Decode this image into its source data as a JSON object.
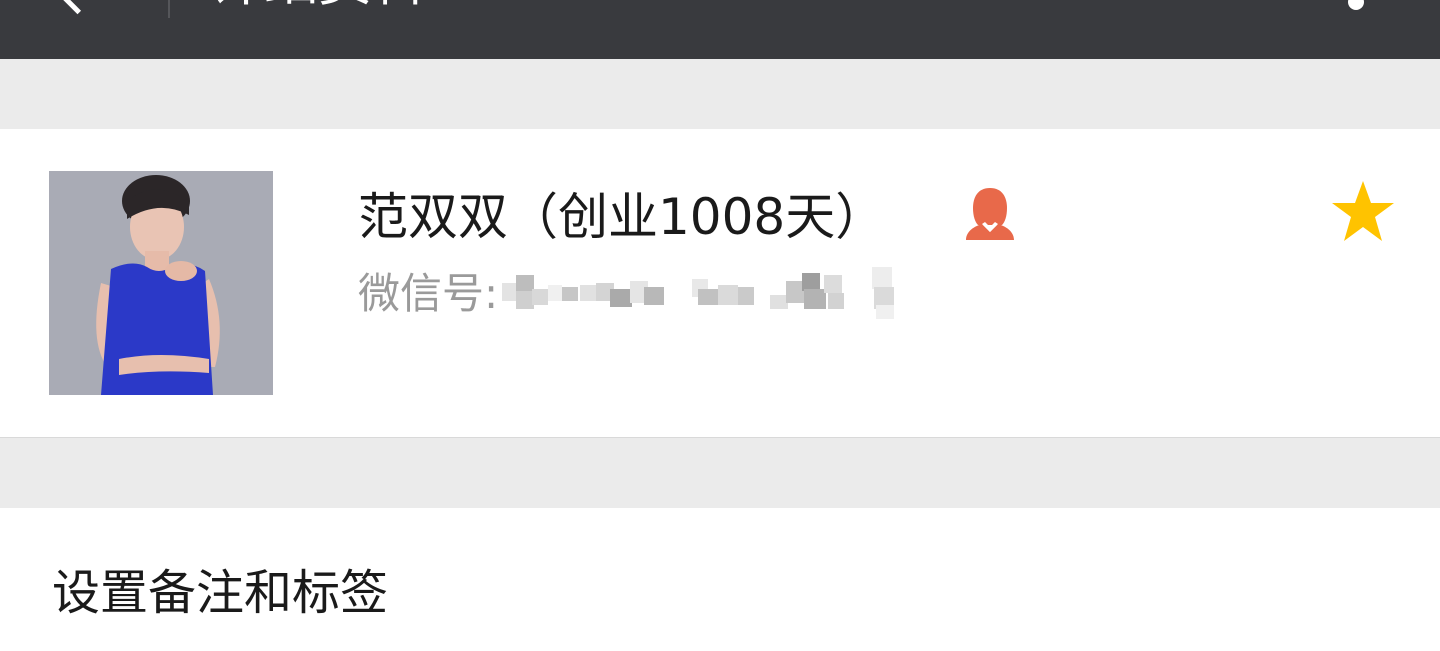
{
  "header": {
    "title": "详细资料",
    "back_icon": "back-arrow-icon",
    "more_icon": "more-icon",
    "background": "#393a3e"
  },
  "profile": {
    "name": "范双双（创业1008天）",
    "gender_icon": "female-user-icon",
    "gender_color": "#e8694a",
    "star_icon": "star-icon",
    "star_color": "#ffc300",
    "wechat_label": "微信号:",
    "avatar": "avatar"
  },
  "menu": {
    "remark_tags_label": "设置备注和标签"
  }
}
